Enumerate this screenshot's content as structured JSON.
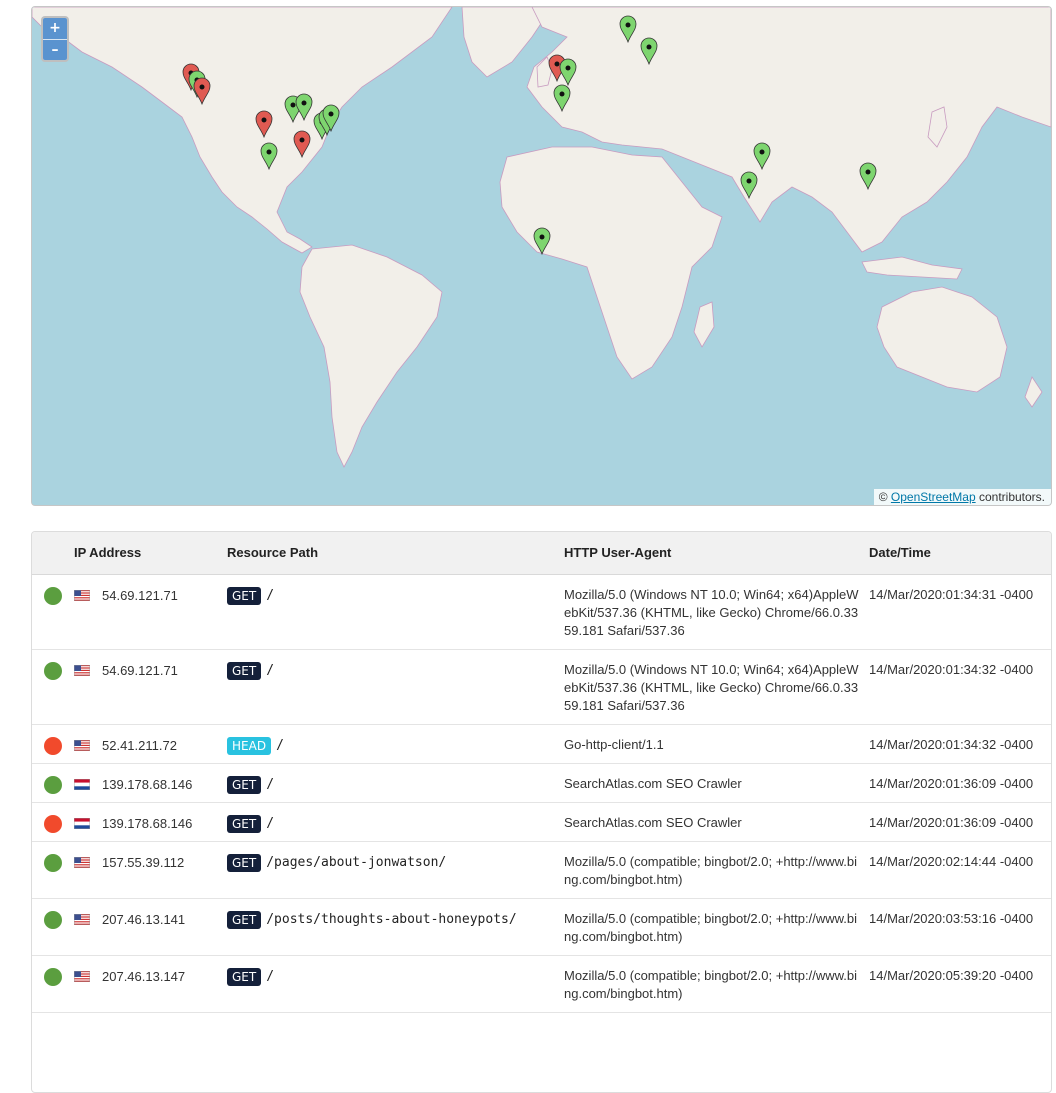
{
  "map": {
    "zoom_in_label": "+",
    "zoom_out_label": "–",
    "attribution_prefix": "©",
    "attribution_link": "OpenStreetMap",
    "attribution_suffix": "contributors.",
    "colors": {
      "water": "#aad3df",
      "land": "#f2efe9",
      "border": "#c89bc0",
      "pin_green": "#7ed56f",
      "pin_red": "#e05a52"
    }
  },
  "table": {
    "headers": {
      "ip": "IP Address",
      "path": "Resource Path",
      "ua": "HTTP User-Agent",
      "dt": "Date/Time"
    },
    "rows": [
      {
        "status": "ok",
        "flag": "us",
        "ip": "54.69.121.71",
        "method": "GET",
        "path": "/",
        "ua": "Mozilla/5.0 (Windows NT 10.0; Win64; x64)AppleWebKit/537.36 (KHTML, like Gecko) Chrome/66.0.3359.181 Safari/537.36",
        "dt": "14/Mar/2020:01:34:31 -0400"
      },
      {
        "status": "ok",
        "flag": "us",
        "ip": "54.69.121.71",
        "method": "GET",
        "path": "/",
        "ua": "Mozilla/5.0 (Windows NT 10.0; Win64; x64)AppleWebKit/537.36 (KHTML, like Gecko) Chrome/66.0.3359.181 Safari/537.36",
        "dt": "14/Mar/2020:01:34:32 -0400"
      },
      {
        "status": "bad",
        "flag": "us",
        "ip": "52.41.211.72",
        "method": "HEAD",
        "path": "/",
        "ua": "Go-http-client/1.1",
        "dt": "14/Mar/2020:01:34:32 -0400"
      },
      {
        "status": "ok",
        "flag": "nl",
        "ip": "139.178.68.146",
        "method": "GET",
        "path": "/",
        "ua": "SearchAtlas.com SEO Crawler",
        "dt": "14/Mar/2020:01:36:09 -0400"
      },
      {
        "status": "bad",
        "flag": "nl",
        "ip": "139.178.68.146",
        "method": "GET",
        "path": "/",
        "ua": "SearchAtlas.com SEO Crawler",
        "dt": "14/Mar/2020:01:36:09 -0400"
      },
      {
        "status": "ok",
        "flag": "us",
        "ip": "157.55.39.112",
        "method": "GET",
        "path": "/pages/about-jonwatson/",
        "ua": "Mozilla/5.0 (compatible; bingbot/2.0; +http://www.bing.com/bingbot.htm)",
        "dt": "14/Mar/2020:02:14:44 -0400"
      },
      {
        "status": "ok",
        "flag": "us",
        "ip": "207.46.13.141",
        "method": "GET",
        "path": "/posts/thoughts-about-honeypots/",
        "ua": "Mozilla/5.0 (compatible; bingbot/2.0; +http://www.bing.com/bingbot.htm)",
        "dt": "14/Mar/2020:03:53:16 -0400"
      },
      {
        "status": "ok",
        "flag": "us",
        "ip": "207.46.13.147",
        "method": "GET",
        "path": "/",
        "ua": "Mozilla/5.0 (compatible; bingbot/2.0; +http://www.bing.com/bingbot.htm)",
        "dt": "14/Mar/2020:05:39:20 -0400"
      }
    ]
  }
}
